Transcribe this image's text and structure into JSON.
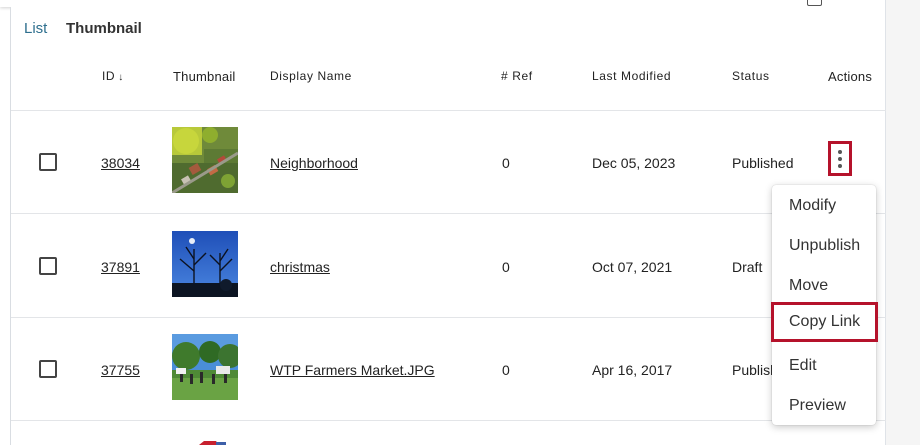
{
  "view_toggle": {
    "list": "List",
    "thumbnail": "Thumbnail"
  },
  "columns": {
    "id": "ID",
    "sort_glyph": "↓",
    "thumbnail": "Thumbnail",
    "display_name": "Display Name",
    "ref": "# Ref",
    "last_modified": "Last Modified",
    "status": "Status",
    "actions": "Actions"
  },
  "rows": [
    {
      "id": "38034",
      "name": "Neighborhood",
      "ref": "0",
      "modified": "Dec 05, 2023",
      "status": "Published",
      "thumbnail_icon": "aerial-neighborhood-photo"
    },
    {
      "id": "37891",
      "name": "christmas",
      "ref": "0",
      "modified": "Oct 07, 2021",
      "status": "Draft",
      "thumbnail_icon": "night-trees-photo"
    },
    {
      "id": "37755",
      "name": "WTP Farmers Market.JPG",
      "ref": "0",
      "modified": "Apr 16, 2017",
      "status": "Publish",
      "thumbnail_icon": "farmers-market-photo"
    }
  ],
  "actions_menu": {
    "items": [
      "Modify",
      "Unpublish",
      "Move",
      "Copy Link",
      "Edit",
      "Preview"
    ],
    "highlighted": "Copy Link"
  },
  "colors": {
    "highlight": "#b5122b",
    "link_blue": "#2e6f8e"
  }
}
